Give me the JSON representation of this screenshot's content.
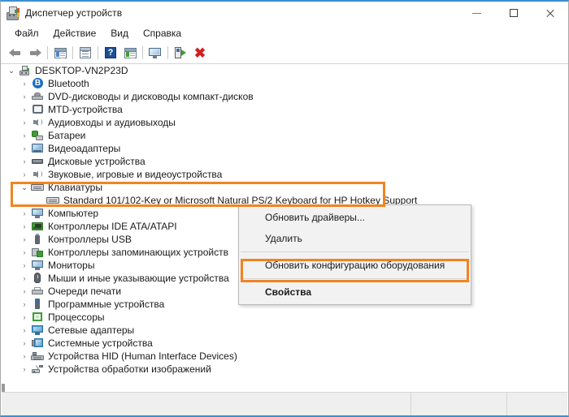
{
  "window": {
    "title": "Диспетчер устройств",
    "icon": "device-manager-icon",
    "minimize_label": "—",
    "maximize_label": "□",
    "close_label": "✕"
  },
  "menubar": {
    "items": [
      {
        "label": "Файл",
        "name": "menu-file"
      },
      {
        "label": "Действие",
        "name": "menu-action"
      },
      {
        "label": "Вид",
        "name": "menu-view"
      },
      {
        "label": "Справка",
        "name": "menu-help"
      }
    ]
  },
  "toolbar": {
    "buttons": [
      {
        "icon": "back-arrow-icon",
        "name": "toolbar-back"
      },
      {
        "icon": "forward-arrow-icon",
        "name": "toolbar-forward"
      },
      {
        "icon": "show-hide-console-tree-icon",
        "name": "toolbar-console-tree"
      },
      {
        "icon": "properties-icon",
        "name": "toolbar-properties"
      },
      {
        "icon": "help-icon",
        "name": "toolbar-help"
      },
      {
        "icon": "scan-view-icon",
        "name": "toolbar-scan-view"
      },
      {
        "icon": "update-driver-icon",
        "name": "toolbar-update-driver"
      },
      {
        "icon": "scan-hardware-changes-icon",
        "name": "toolbar-scan-hardware"
      },
      {
        "icon": "disable-device-icon",
        "name": "toolbar-disable-device"
      }
    ]
  },
  "tree": {
    "root": {
      "label": "DESKTOP-VN2P23D",
      "icon": "computer-icon",
      "expanded": true,
      "chevron": "⌄"
    },
    "items": [
      {
        "label": "Bluetooth",
        "icon": "bluetooth-icon",
        "chevron": "›",
        "expanded": false
      },
      {
        "label": "DVD-дисководы и дисководы компакт-дисков",
        "icon": "dvd-drive-icon",
        "chevron": "›",
        "expanded": false
      },
      {
        "label": "MTD-устройства",
        "icon": "mtd-device-icon",
        "chevron": "›",
        "expanded": false
      },
      {
        "label": "Аудиовходы и аудиовыходы",
        "icon": "audio-io-icon",
        "chevron": "›",
        "expanded": false
      },
      {
        "label": "Батареи",
        "icon": "battery-icon",
        "chevron": "›",
        "expanded": false
      },
      {
        "label": "Видеоадаптеры",
        "icon": "display-adapter-icon",
        "chevron": "›",
        "expanded": false
      },
      {
        "label": "Дисковые устройства",
        "icon": "disk-drive-icon",
        "chevron": "›",
        "expanded": false
      },
      {
        "label": "Звуковые, игровые и видеоустройства",
        "icon": "sound-video-game-icon",
        "chevron": "›",
        "expanded": false
      },
      {
        "label": "Клавиатуры",
        "icon": "keyboard-icon",
        "chevron": "⌄",
        "expanded": true,
        "highlighted": true
      },
      {
        "label": "Компьютер",
        "icon": "computer-node-icon",
        "chevron": "›",
        "expanded": false
      },
      {
        "label": "Контроллеры IDE ATA/ATAPI",
        "icon": "ide-controller-icon",
        "chevron": "›",
        "expanded": false
      },
      {
        "label": "Контроллеры USB",
        "icon": "usb-controller-icon",
        "chevron": "›",
        "expanded": false
      },
      {
        "label": "Контроллеры запоминающих устройств",
        "icon": "storage-controller-icon",
        "chevron": "›",
        "expanded": false
      },
      {
        "label": "Мониторы",
        "icon": "monitor-icon",
        "chevron": "›",
        "expanded": false
      },
      {
        "label": "Мыши и иные указывающие устройства",
        "icon": "mouse-icon",
        "chevron": "›",
        "expanded": false
      },
      {
        "label": "Очереди печати",
        "icon": "print-queue-icon",
        "chevron": "›",
        "expanded": false
      },
      {
        "label": "Программные устройства",
        "icon": "software-device-icon",
        "chevron": "›",
        "expanded": false
      },
      {
        "label": "Процессоры",
        "icon": "processor-icon",
        "chevron": "›",
        "expanded": false
      },
      {
        "label": "Сетевые адаптеры",
        "icon": "network-adapter-icon",
        "chevron": "›",
        "expanded": false
      },
      {
        "label": "Системные устройства",
        "icon": "system-device-icon",
        "chevron": "›",
        "expanded": false
      },
      {
        "label": "Устройства HID (Human Interface Devices)",
        "icon": "hid-device-icon",
        "chevron": "›",
        "expanded": false
      },
      {
        "label": "Устройства обработки изображений",
        "icon": "imaging-device-icon",
        "chevron": "›",
        "expanded": false
      }
    ],
    "keyboard_child": {
      "label": "Standard 101/102-Key or Microsoft Natural PS/2 Keyboard for HP Hotkey Support",
      "icon": "keyboard-device-icon",
      "selected": true
    }
  },
  "context_menu": {
    "items": [
      {
        "label": "Обновить драйверы...",
        "name": "ctx-update-drivers",
        "bold": false,
        "separator_after": false
      },
      {
        "label": "Удалить",
        "name": "ctx-uninstall",
        "bold": false,
        "separator_after": true
      },
      {
        "label": "Обновить конфигурацию оборудования",
        "name": "ctx-scan-hardware-changes",
        "bold": false,
        "separator_after": true
      },
      {
        "label": "Свойства",
        "name": "ctx-properties",
        "bold": true,
        "separator_after": false
      }
    ]
  },
  "annotations": {
    "highlight_color": "#f08422",
    "boxes": [
      {
        "name": "highlight-keyboards-node",
        "target": "Клавиатуры"
      },
      {
        "name": "highlight-properties-item",
        "target": "Свойства"
      }
    ]
  },
  "statusbar": {
    "pane1": "",
    "pane2": "",
    "pane3": ""
  },
  "colors": {
    "window_accent": "#3d8fd1",
    "highlight": "#f08422",
    "menu_bg": "#f2f2f2",
    "status_bg": "#efefef"
  }
}
